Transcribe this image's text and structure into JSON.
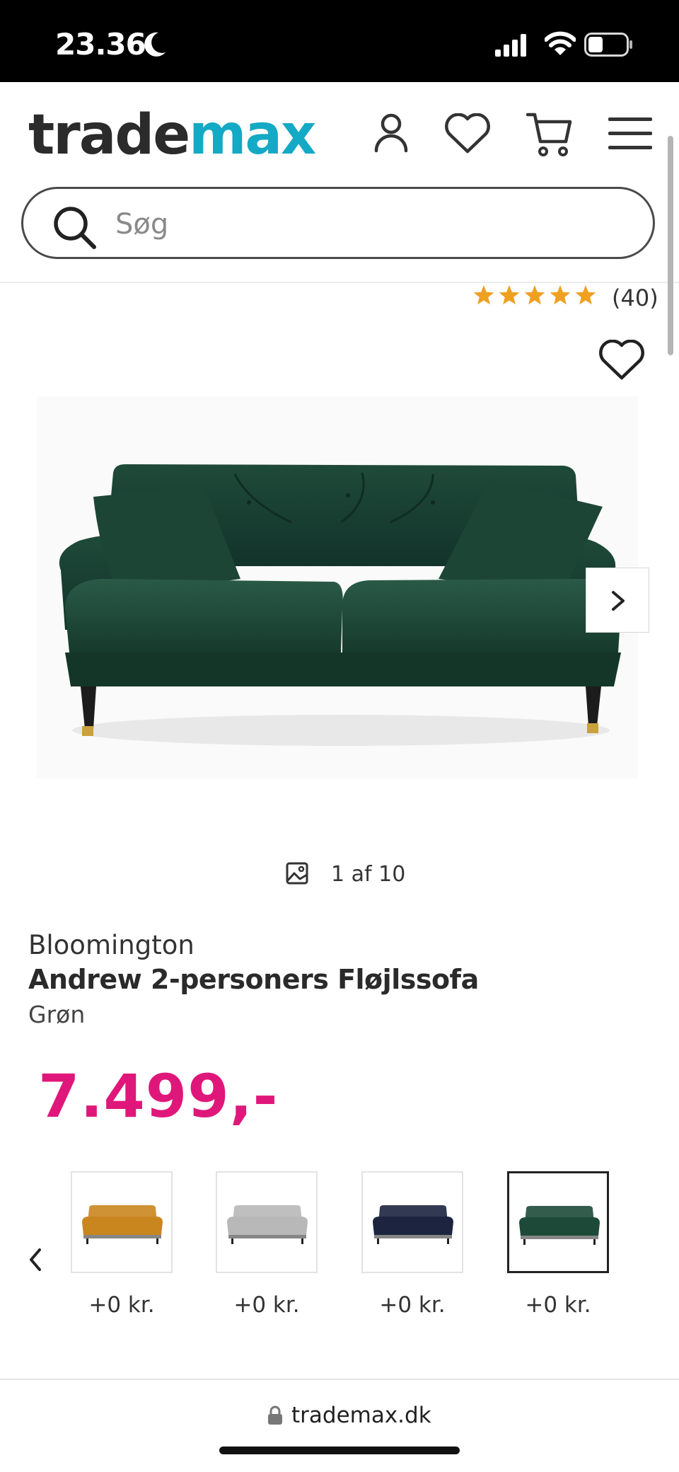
{
  "status_bar": {
    "time": "23.36"
  },
  "header": {
    "logo_part1": "trade",
    "logo_part2": "max",
    "search_placeholder": "Søg"
  },
  "rating": {
    "stars": 4.5,
    "count": "(40)"
  },
  "gallery": {
    "counter": "1 af 10"
  },
  "product": {
    "brand": "Bloomington",
    "name": "Andrew 2-personers Fløjlssofa",
    "color": "Grøn",
    "price": "7.499,-"
  },
  "variants": [
    {
      "color_name": "orange",
      "color": "#c9861f",
      "price": "+0 kr.",
      "selected": false
    },
    {
      "color_name": "grey",
      "color": "#b8b8b8",
      "price": "+0 kr.",
      "selected": false
    },
    {
      "color_name": "navy",
      "color": "#1c2440",
      "price": "+0 kr.",
      "selected": false
    },
    {
      "color_name": "green",
      "color": "#1d4a38",
      "price": "+0 kr.",
      "selected": true
    }
  ],
  "browser": {
    "url": "trademax.dk"
  },
  "colors": {
    "brand_teal": "#14a9c4",
    "price_pink": "#e0177a",
    "star_orange": "#f0a020",
    "sofa_green": "#1f4a3a"
  }
}
